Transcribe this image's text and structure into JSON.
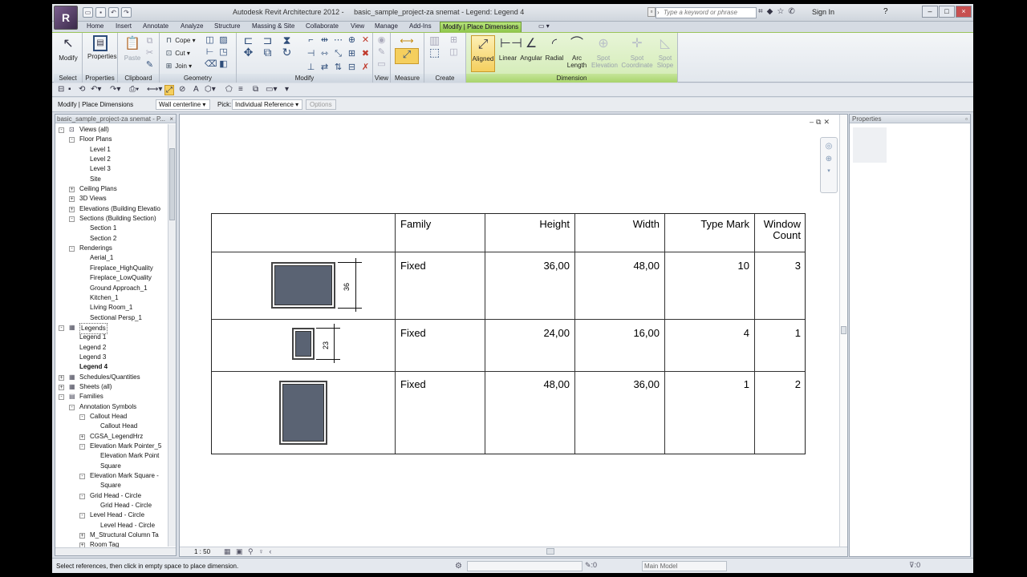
{
  "titlebar": {
    "app_title": "Autodesk Revit Architecture 2012 -",
    "doc_title": "basic_sample_project-za snemat - Legend: Legend 4",
    "search_placeholder": "Type a keyword or phrase",
    "sign_in": "Sign In",
    "help": "?"
  },
  "tabs": [
    {
      "label": "Home"
    },
    {
      "label": "Insert"
    },
    {
      "label": "Annotate"
    },
    {
      "label": "Analyze"
    },
    {
      "label": "Structure"
    },
    {
      "label": "Massing & Site"
    },
    {
      "label": "Collaborate"
    },
    {
      "label": "View"
    },
    {
      "label": "Manage"
    },
    {
      "label": "Add-Ins"
    },
    {
      "label": "Modify | Place Dimensions"
    }
  ],
  "ribbon": {
    "select": {
      "modify": "Modify",
      "label": "Select"
    },
    "properties": {
      "btn": "Properties",
      "label": "Properties"
    },
    "clipboard": {
      "paste": "Paste",
      "label": "Clipboard"
    },
    "geometry": {
      "cope": "Cope",
      "cut": "Cut",
      "join": "Join",
      "label": "Geometry"
    },
    "modify": {
      "label": "Modify"
    },
    "view": {
      "label": "View"
    },
    "measure": {
      "label": "Measure"
    },
    "create": {
      "label": "Create"
    },
    "dimension": {
      "label": "Dimension",
      "aligned": "Aligned",
      "linear": "Linear",
      "angular": "Angular",
      "radial": "Radial",
      "arc_length_1": "Arc",
      "arc_length_2": "Length",
      "spot_elev_1": "Spot",
      "spot_elev_2": "Elevation",
      "spot_coord_1": "Spot",
      "spot_coord_2": "Coordinate",
      "spot_slope_1": "Spot",
      "spot_slope_2": "Slope"
    }
  },
  "options_bar": {
    "context": "Modify | Place Dimensions",
    "reference": "Wall centerline",
    "pick_label": "Pick:",
    "pick_value": "Individual Reference",
    "options": "Options"
  },
  "browser": {
    "header": "basic_sample_project-za snemat - P...",
    "nodes": [
      {
        "t": "Views (all)"
      },
      {
        "t": "Floor Plans"
      },
      {
        "t": "Level 1"
      },
      {
        "t": "Level 2"
      },
      {
        "t": "Level 3"
      },
      {
        "t": "Site"
      },
      {
        "t": "Ceiling Plans"
      },
      {
        "t": "3D Views"
      },
      {
        "t": "Elevations (Building Elevatio"
      },
      {
        "t": "Sections (Building Section)"
      },
      {
        "t": "Section 1"
      },
      {
        "t": "Section 2"
      },
      {
        "t": "Renderings"
      },
      {
        "t": "Aerial_1"
      },
      {
        "t": "Fireplace_HighQuality"
      },
      {
        "t": "Fireplace_LowQuality"
      },
      {
        "t": "Ground Approach_1"
      },
      {
        "t": "Kitchen_1"
      },
      {
        "t": "Living Room_1"
      },
      {
        "t": "Sectional Persp_1"
      },
      {
        "t": "Legends"
      },
      {
        "t": "Legend 1"
      },
      {
        "t": "Legend 2"
      },
      {
        "t": "Legend 3"
      },
      {
        "t": "Legend 4"
      },
      {
        "t": "Schedules/Quantities"
      },
      {
        "t": "Sheets (all)"
      },
      {
        "t": "Families"
      },
      {
        "t": "Annotation Symbols"
      },
      {
        "t": "Callout Head"
      },
      {
        "t": "Callout Head"
      },
      {
        "t": "CGSA_LegendHrz"
      },
      {
        "t": "Elevation Mark Pointer_5"
      },
      {
        "t": "Elevation Mark Point"
      },
      {
        "t": "Square"
      },
      {
        "t": "Elevation Mark Square -"
      },
      {
        "t": "Square"
      },
      {
        "t": "Grid Head - Circle"
      },
      {
        "t": "Grid Head - Circle"
      },
      {
        "t": "Level Head - Circle"
      },
      {
        "t": "Level Head - Circle"
      },
      {
        "t": "M_Structural Column Ta"
      },
      {
        "t": "Room Tag"
      }
    ]
  },
  "legend": {
    "headers": {
      "family": "Family",
      "height": "Height",
      "width": "Width",
      "type_mark": "Type Mark",
      "count_1": "Window",
      "count_2": "Count"
    },
    "rows": [
      {
        "family": "Fixed",
        "height": "36,00",
        "width": "48,00",
        "type_mark": "10",
        "count": "3",
        "dim": "36"
      },
      {
        "family": "Fixed",
        "height": "24,00",
        "width": "16,00",
        "type_mark": "4",
        "count": "1",
        "dim": "23"
      },
      {
        "family": "Fixed",
        "height": "48,00",
        "width": "36,00",
        "type_mark": "1",
        "count": "2"
      }
    ]
  },
  "view": {
    "scale": "1 : 50"
  },
  "properties": {
    "header": "Properties"
  },
  "status": {
    "message": "Select references, then click in empty space to place dimension.",
    "edit_count": ":0",
    "model": "Main Model",
    "filter": ":0"
  }
}
